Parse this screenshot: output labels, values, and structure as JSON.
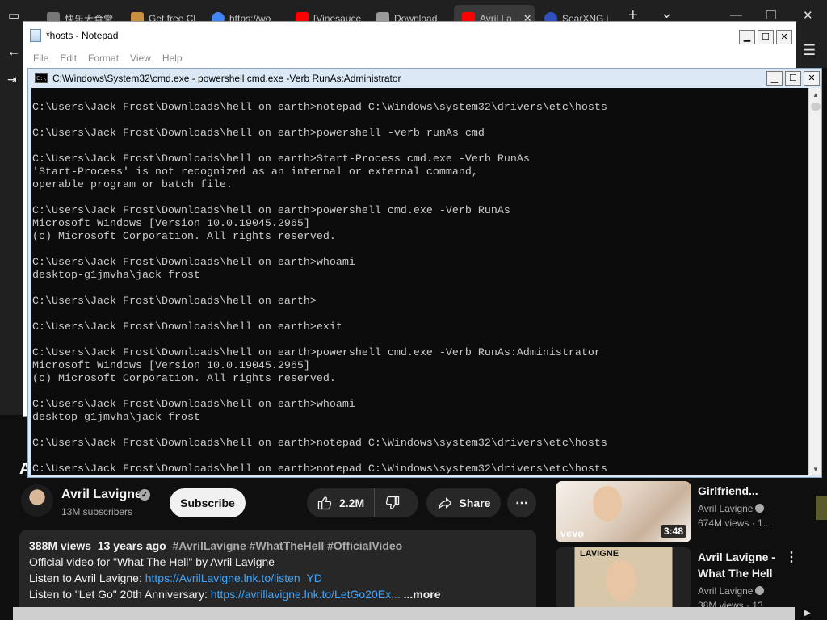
{
  "browser": {
    "tabs": [
      {
        "label": "快乐大食堂",
        "favicon_color": "#888888"
      },
      {
        "label": "Get free Cl",
        "favicon_color": "#c89040"
      },
      {
        "label": "https://wo",
        "favicon_color": "#4285f4"
      },
      {
        "label": "[Vinesauce",
        "favicon_color": "#ff0000"
      },
      {
        "label": "Download",
        "favicon_color": "#9a9a9a"
      },
      {
        "label": "Avril La",
        "favicon_color": "#ff0000",
        "active": true
      },
      {
        "label": "SearXNG i",
        "favicon_color": "#3050c0"
      }
    ],
    "new_tab_symbol": "+",
    "tab_list_symbol": "⌄",
    "menu_symbol": "☰"
  },
  "notepad": {
    "title": "*hosts - Notepad",
    "menu": [
      "File",
      "Edit",
      "Format",
      "View",
      "Help"
    ]
  },
  "cmd": {
    "title": "C:\\Windows\\System32\\cmd.exe - powershell  cmd.exe -Verb RunAs:Administrator",
    "icon_text": "C:\\",
    "lines": [
      "",
      "C:\\Users\\Jack Frost\\Downloads\\hell on earth>notepad C:\\Windows\\system32\\drivers\\etc\\hosts",
      "",
      "C:\\Users\\Jack Frost\\Downloads\\hell on earth>powershell -verb runAs cmd",
      "",
      "C:\\Users\\Jack Frost\\Downloads\\hell on earth>Start-Process cmd.exe -Verb RunAs",
      "'Start-Process' is not recognized as an internal or external command,",
      "operable program or batch file.",
      "",
      "C:\\Users\\Jack Frost\\Downloads\\hell on earth>powershell cmd.exe -Verb RunAs",
      "Microsoft Windows [Version 10.0.19045.2965]",
      "(c) Microsoft Corporation. All rights reserved.",
      "",
      "C:\\Users\\Jack Frost\\Downloads\\hell on earth>whoami",
      "desktop-g1jmvha\\jack frost",
      "",
      "C:\\Users\\Jack Frost\\Downloads\\hell on earth>",
      "",
      "C:\\Users\\Jack Frost\\Downloads\\hell on earth>exit",
      "",
      "C:\\Users\\Jack Frost\\Downloads\\hell on earth>powershell cmd.exe -Verb RunAs:Administrator",
      "Microsoft Windows [Version 10.0.19045.2965]",
      "(c) Microsoft Corporation. All rights reserved.",
      "",
      "C:\\Users\\Jack Frost\\Downloads\\hell on earth>whoami",
      "desktop-g1jmvha\\jack frost",
      "",
      "C:\\Users\\Jack Frost\\Downloads\\hell on earth>notepad C:\\Windows\\system32\\drivers\\etc\\hosts",
      "",
      "C:\\Users\\Jack Frost\\Downloads\\hell on earth>notepad C:\\Windows\\system32\\drivers\\etc\\hosts"
    ]
  },
  "youtube": {
    "ghost_title": "A",
    "channel_name": "Avril Lavigne",
    "subscribers": "13M subscribers",
    "subscribe_label": "Subscribe",
    "likes": "2.2M",
    "share_label": "Share",
    "description": {
      "views": "388M views",
      "age": "13 years ago",
      "tags": "#AvrilLavigne #WhatTheHell #OfficialVideo",
      "line1": "Official video for \"What The Hell\" by Avril Lavigne",
      "line2_text": "Listen to Avril Lavigne: ",
      "line2_link": "https://AvrilLavigne.lnk.to/listen_YD",
      "line3_text": "Listen to \"Let Go\" 20th Anniversary: ",
      "line3_link": "https://avrillavigne.lnk.to/LetGo20Ex...",
      "more_label": "...more"
    },
    "recommendations": [
      {
        "title": "Girlfriend...",
        "channel": "Avril Lavigne",
        "views": "674M views · 1...",
        "duration": "3:48",
        "badge": "vevo"
      },
      {
        "title_line1": "Avril Lavigne -",
        "title_line2": "What The Hell",
        "channel": "Avril Lavigne",
        "views": "38M views · 13...",
        "thumb_label": "LAVIGNE"
      }
    ]
  }
}
